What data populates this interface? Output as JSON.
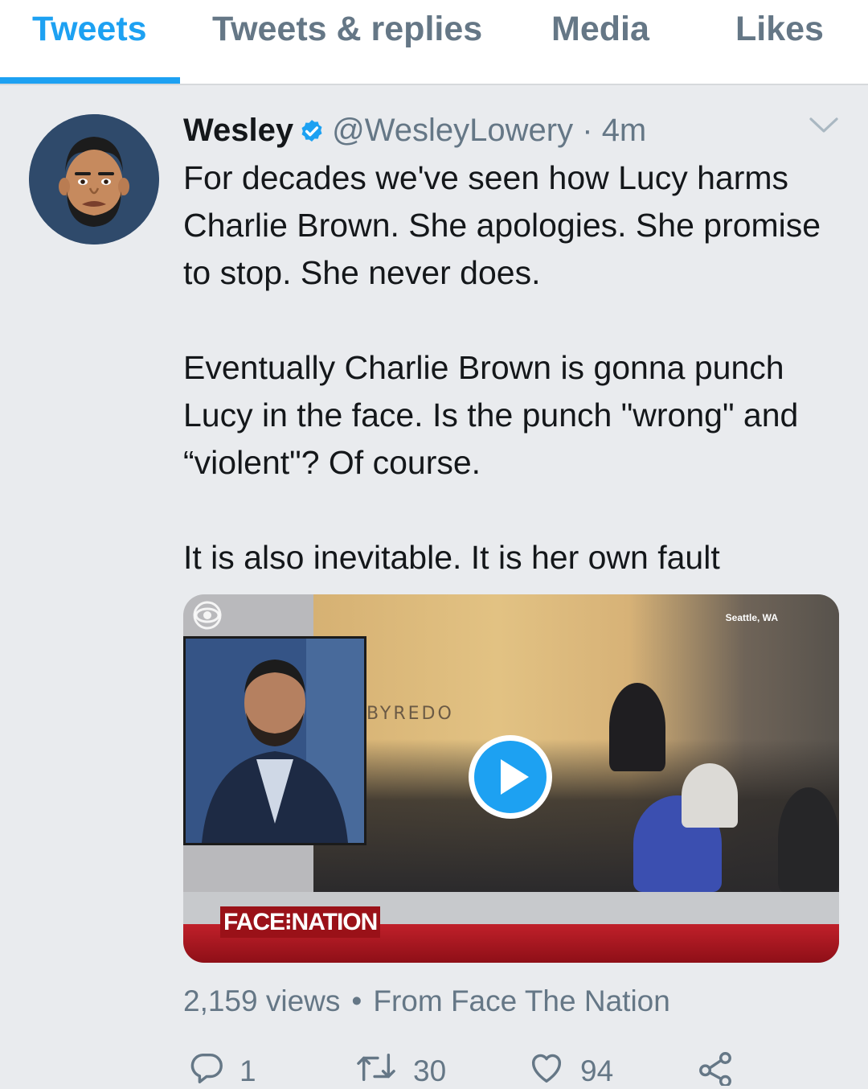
{
  "tabs": [
    {
      "label": "Tweets",
      "active": true
    },
    {
      "label": "Tweets & replies",
      "active": false
    },
    {
      "label": "Media",
      "active": false
    },
    {
      "label": "Likes",
      "active": false
    }
  ],
  "tweet": {
    "display_name": "Wesley",
    "handle": "@WesleyLowery",
    "separator": "·",
    "time": "4m",
    "verified": true,
    "paragraphs": [
      "For decades we've seen how Lucy harms Charlie Brown. She apologies. She promise to stop. She never does.",
      "Eventually Charlie Brown is gonna punch Lucy in the face. Is the punch \"wrong\" and “violent\"? Of course.",
      "It is also inevitable. It is her own fault"
    ],
    "media": {
      "store_sign": "BYREDO",
      "location": "Seattle, WA",
      "show_logo": "FACE⁝NATION"
    },
    "views": "2,159 views",
    "dot": "•",
    "source": "From Face The Nation",
    "replies": "1",
    "retweets": "30",
    "likes": "94"
  },
  "colors": {
    "accent": "#1da1f2",
    "muted": "#657786",
    "background": "#e9ebee",
    "text": "#14171a"
  },
  "icons": [
    "verified-badge-icon",
    "chevron-down-icon",
    "play-icon",
    "cbs-eye-icon",
    "reply-icon",
    "retweet-icon",
    "like-icon",
    "share-icon"
  ]
}
